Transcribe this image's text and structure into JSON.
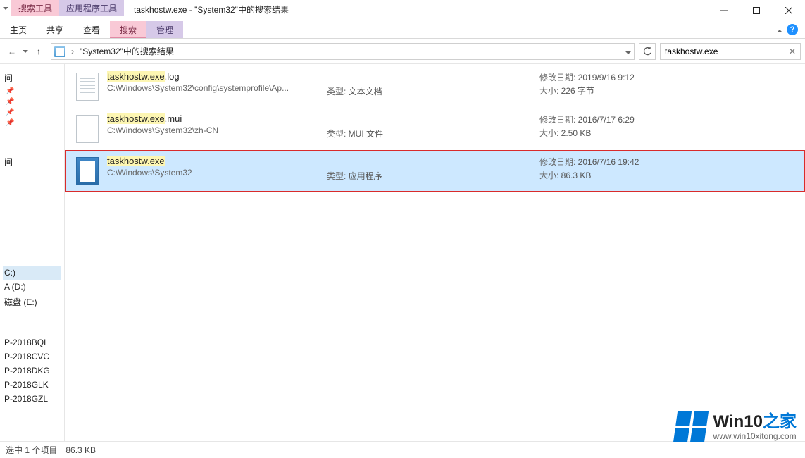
{
  "title": "taskhostw.exe - \"System32\"中的搜索结果",
  "contextual_tabs": {
    "search": "搜索工具",
    "app": "应用程序工具"
  },
  "ribbon": {
    "tabs": {
      "home": "主页",
      "share": "共享",
      "view": "查看",
      "search": "搜索",
      "manage": "管理"
    }
  },
  "addressbar": {
    "crumb": "\"System32\"中的搜索结果",
    "sep": "›"
  },
  "searchbox": {
    "value": "taskhostw.exe"
  },
  "sidebar": {
    "quick": "问",
    "pins": [
      "",
      "",
      "",
      ""
    ],
    "group_pc": [
      "间"
    ],
    "drives": [
      "C:)",
      "A (D:)",
      "磁盘 (E:)"
    ],
    "net_label": "",
    "network": [
      "P-2018BQI",
      "P-2018CVC",
      "P-2018DKG",
      "P-2018GLK",
      "P-2018GZL"
    ]
  },
  "results": [
    {
      "name_hl": "taskhostw.exe",
      "name_tail": ".log",
      "path": "C:\\Windows\\System32\\config\\systemprofile\\Ap...",
      "type_label": "类型:",
      "type_value": "文本文档",
      "date_label": "修改日期:",
      "date_value": "2019/9/16 9:12",
      "size_label": "大小:",
      "size_value": "226 字节",
      "icon": "txt"
    },
    {
      "name_hl": "taskhostw.exe",
      "name_tail": ".mui",
      "path": "C:\\Windows\\System32\\zh-CN",
      "type_label": "类型:",
      "type_value": "MUI 文件",
      "date_label": "修改日期:",
      "date_value": "2016/7/17 6:29",
      "size_label": "大小:",
      "size_value": "2.50 KB",
      "icon": "mui"
    },
    {
      "name_hl": "taskhostw.exe",
      "name_tail": "",
      "path": "C:\\Windows\\System32",
      "type_label": "类型:",
      "type_value": "应用程序",
      "date_label": "修改日期:",
      "date_value": "2016/7/16 19:42",
      "size_label": "大小:",
      "size_value": "86.3 KB",
      "icon": "exe",
      "selected": true
    }
  ],
  "statusbar": {
    "selected": "选中 1 个项目",
    "size": "86.3 KB"
  },
  "watermark": {
    "brand_a": "Win10",
    "brand_b": "之家",
    "url": "www.win10xitong.com"
  }
}
